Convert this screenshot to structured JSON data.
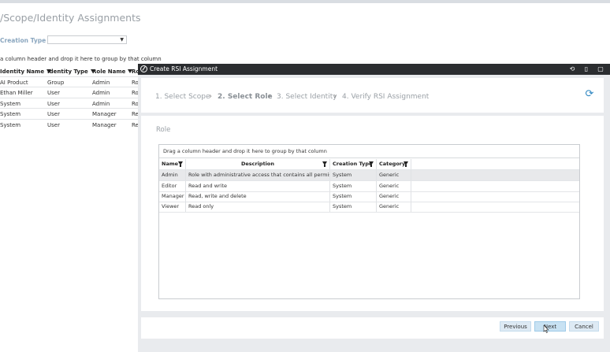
{
  "page": {
    "title": "/Scope/Identity Assignments",
    "filter_label": "Creation Type",
    "filter_value": "",
    "group_hint": "a column header and drop it here to group by that column",
    "columns": [
      "Identity Name",
      "Identity Type",
      "Role Name",
      "Ro"
    ],
    "rows": [
      [
        "AI Product",
        "Group",
        "Admin",
        "Ro"
      ],
      [
        "Ethan Miller",
        "User",
        "Admin",
        "Ro"
      ],
      [
        "System",
        "User",
        "Admin",
        "Ro"
      ],
      [
        "System",
        "User",
        "Manager",
        "Re"
      ],
      [
        "System",
        "User",
        "Manager",
        "Re"
      ]
    ]
  },
  "modal": {
    "title": "Create RSI Assignment",
    "steps": [
      {
        "label": "1. Select Scope",
        "active": false
      },
      {
        "label": "2. Select Role",
        "active": true
      },
      {
        "label": "3. Select Identity",
        "active": false
      },
      {
        "label": "4. Verify RSI Assignment",
        "active": false
      }
    ],
    "section_title": "Role",
    "group_hint": "Drag a column header and drop it here to group by that column",
    "columns": [
      "Name",
      "Description",
      "Creation Type",
      "Category"
    ],
    "rows": [
      [
        "Admin",
        "Role with administrative access that contains all permissions",
        "System",
        "Generic"
      ],
      [
        "Editor",
        "Read and write",
        "System",
        "Generic"
      ],
      [
        "Manager",
        "Read, write and delete",
        "System",
        "Generic"
      ],
      [
        "Viewer",
        "Read only",
        "System",
        "Generic"
      ]
    ],
    "buttons": {
      "previous": "Previous",
      "next": "Next",
      "cancel": "Cancel"
    },
    "colors": {
      "titlebar": "#2b2d30",
      "accent": "#2e86c1",
      "button": "#deeaf4"
    }
  }
}
